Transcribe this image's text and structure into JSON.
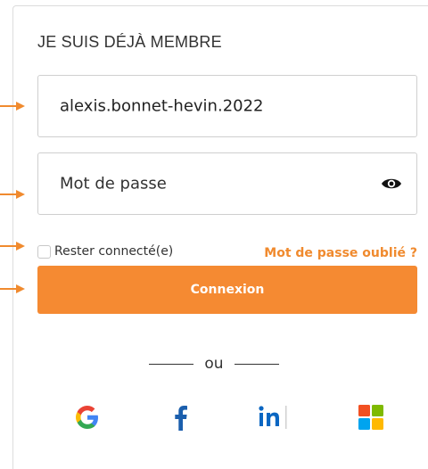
{
  "login": {
    "heading": "JE SUIS DÉJÀ MEMBRE",
    "username_value": "alexis.bonnet-hevin.2022",
    "password_placeholder": "Mot de passe",
    "remember_label": "Rester connecté(e)",
    "forgot_label": "Mot de passe oublié ?",
    "submit_label": "Connexion",
    "separator": "ou"
  },
  "social": [
    {
      "icon": "google-icon"
    },
    {
      "icon": "facebook-icon"
    },
    {
      "icon": "linkedin-icon"
    },
    {
      "icon": "microsoft-icon"
    }
  ],
  "colors": {
    "accent": "#f58a32",
    "arrow": "#f08a2e"
  }
}
